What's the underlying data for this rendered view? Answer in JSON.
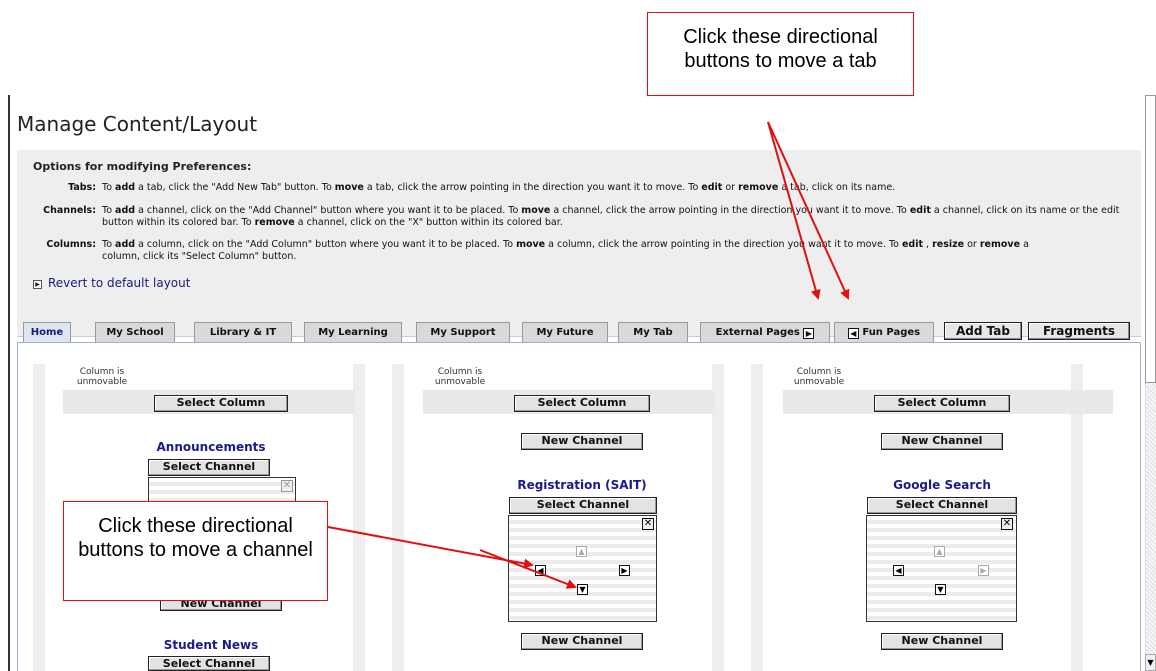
{
  "page_title": "Manage Content/Layout",
  "options": {
    "heading": "Options for modifying Preferences:",
    "tabs": {
      "label": "Tabs:",
      "t1": "To ",
      "add": "add",
      "t2": " a tab, click the \"Add New Tab\" button. To ",
      "move": "move",
      "t3": " a tab, click the arrow pointing in the direction you want it to move. To ",
      "edit": "edit",
      "t4": " or ",
      "remove": "remove",
      "t5": " a tab, click on its name."
    },
    "channels": {
      "label": "Channels:",
      "t1": "To ",
      "add": "add",
      "t2": " a channel, click on the \"Add Channel\" button where you want it to be placed. To ",
      "move": "move",
      "t3": " a channel, click the arrow pointing in the direction you want it to move. To ",
      "edit": "edit",
      "t4": " a channel, click on its name or the edit button within its colored bar. To ",
      "remove": "remove",
      "t5": " a channel, click on the \"X\" button within its colored bar."
    },
    "columns": {
      "label": "Columns:",
      "t1": "To ",
      "add": "add",
      "t2": " a column, click on the \"Add Column\" button where you want it to be placed. To ",
      "move": "move",
      "t3": " a column, click the arrow pointing in the direction you want it to move. To ",
      "edit": "edit",
      "t4": " , ",
      "resize": "resize",
      "t5": " or ",
      "remove": "remove",
      "t6": " a column, click its \"Select Column\" button."
    },
    "revert": "Revert to default layout"
  },
  "tabs": [
    {
      "label": "Home"
    },
    {
      "label": "My School"
    },
    {
      "label": "Library & IT"
    },
    {
      "label": "My Learning"
    },
    {
      "label": "My Support"
    },
    {
      "label": "My Future"
    },
    {
      "label": "My Tab"
    },
    {
      "label": "External Pages"
    },
    {
      "label": "Fun Pages"
    }
  ],
  "tab_buttons": {
    "add": "Add Tab",
    "fragments": "Fragments"
  },
  "columns": {
    "unmovable": "Column is unmovable",
    "select_column": "Select Column",
    "new_channel": "New Channel",
    "select_channel": "Select Channel"
  },
  "channels": {
    "col1": [
      "Announcements",
      "Student News"
    ],
    "col2": [
      "Registration (SAIT)"
    ],
    "col3": [
      "Google Search"
    ]
  },
  "callouts": {
    "tab": "Click these directional buttons to move a tab",
    "channel": "Click these directional buttons to move a channel"
  },
  "colors": {
    "accent_red": "#e01010",
    "link_blue": "#1a1a8c",
    "panel_gray": "#eeeeee"
  }
}
